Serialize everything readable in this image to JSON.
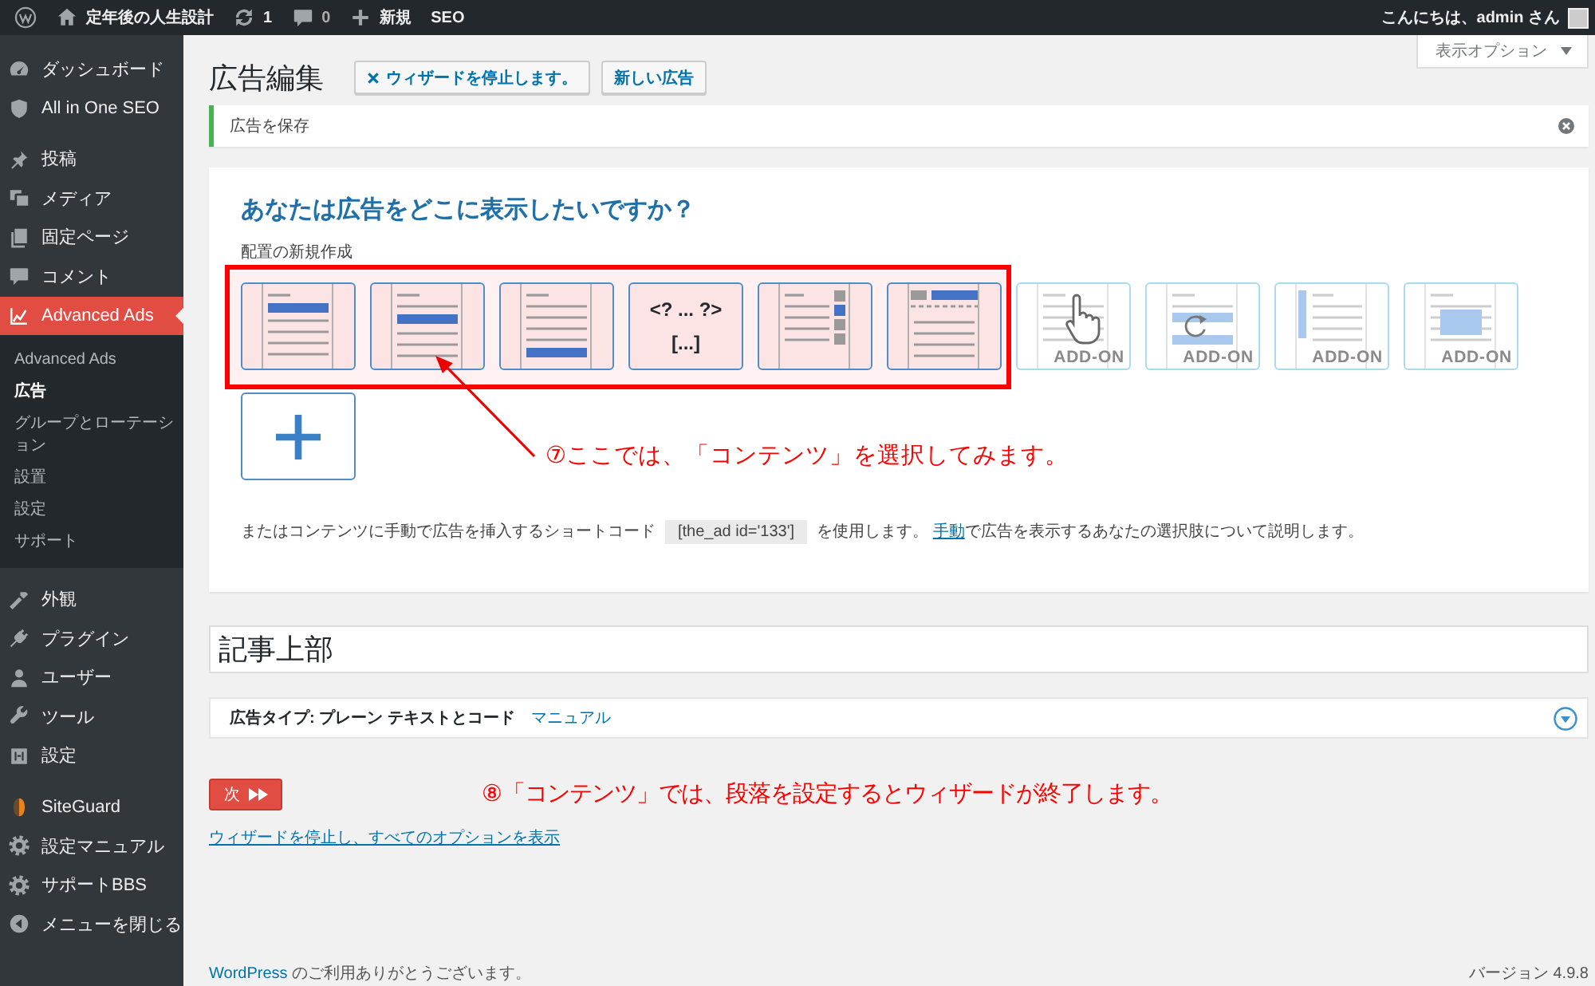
{
  "admin_bar": {
    "site_name": "定年後の人生設計",
    "updates": "1",
    "comments": "0",
    "new_label": "新規",
    "seo": "SEO",
    "greeting": "こんにちは、admin さん"
  },
  "sidebar": {
    "groups": [
      [
        {
          "label": "ダッシュボード",
          "selected": false
        },
        {
          "label": "All in One SEO",
          "selected": false
        }
      ],
      [
        {
          "label": "投稿",
          "selected": false
        },
        {
          "label": "メディア",
          "selected": false
        },
        {
          "label": "固定ページ",
          "selected": false
        },
        {
          "label": "コメント",
          "selected": false
        },
        {
          "label": "Advanced Ads",
          "selected": true,
          "children": [
            {
              "label": "Advanced Ads",
              "selected": false
            },
            {
              "label": "広告",
              "selected": true
            },
            {
              "label": "グループとローテーション",
              "selected": false
            },
            {
              "label": "設置",
              "selected": false
            },
            {
              "label": "設定",
              "selected": false
            },
            {
              "label": "サポート",
              "selected": false
            }
          ]
        }
      ],
      [
        {
          "label": "外観",
          "selected": false
        },
        {
          "label": "プラグイン",
          "selected": false
        },
        {
          "label": "ユーザー",
          "selected": false
        },
        {
          "label": "ツール",
          "selected": false
        },
        {
          "label": "設定",
          "selected": false
        }
      ],
      [
        {
          "label": "SiteGuard",
          "selected": false
        },
        {
          "label": "設定マニュアル",
          "selected": false
        },
        {
          "label": "サポートBBS",
          "selected": false
        },
        {
          "label": "メニューを閉じる",
          "selected": false
        }
      ]
    ]
  },
  "screen_options": {
    "label": "表示オプション",
    "expanded": false
  },
  "header": {
    "title": "広告編集",
    "buttons": [
      {
        "label": "ウィザードを停止します。",
        "kind": "close"
      },
      {
        "label": "新しい広告",
        "kind": "plain"
      }
    ]
  },
  "notice": {
    "text": "広告を保存"
  },
  "wizard": {
    "heading": "あなたは広告をどこに表示したいですか？",
    "label": "配置の新規作成",
    "placements": [
      {
        "kind": "top-bar",
        "highlighted": true,
        "disabled": false
      },
      {
        "kind": "middle-bar",
        "highlighted": true,
        "disabled": false
      },
      {
        "kind": "bottom-bar",
        "highlighted": true,
        "disabled": false
      },
      {
        "kind": "code",
        "lines": [
          "<? ... ?>",
          "[...]"
        ],
        "highlighted": true,
        "disabled": false
      },
      {
        "kind": "side-squares",
        "highlighted": true,
        "disabled": false
      },
      {
        "kind": "header-strip",
        "highlighted": true,
        "disabled": false
      },
      {
        "kind": "hand",
        "badge": "ADD-ON",
        "highlighted": false,
        "disabled": true
      },
      {
        "kind": "rotate",
        "badge": "ADD-ON",
        "highlighted": false,
        "disabled": true
      },
      {
        "kind": "left-bar",
        "badge": "ADD-ON",
        "highlighted": false,
        "disabled": true
      },
      {
        "kind": "center-block",
        "badge": "ADD-ON",
        "highlighted": false,
        "disabled": true
      }
    ],
    "help": {
      "before": "またはコンテンツに手動で広告を挿入するショートコード",
      "code": "[the_ad id='133']",
      "middle": "を使用します。",
      "link": "手動",
      "after": "で広告を表示するあなたの選択肢について説明します。"
    }
  },
  "ad_title": {
    "value": "記事上部"
  },
  "ad_type": {
    "label": "広告タイプ: プレーン テキストとコード",
    "link": "マニュアル",
    "expanded": false
  },
  "next_button": {
    "label": "次"
  },
  "stop_link": "ウィザードを停止し、すべてのオプションを表示",
  "annotations": [
    {
      "text": "⑦ここでは、「コンテンツ」を選択してみます。"
    },
    {
      "text": "⑧「コンテンツ」では、段落を設定するとウィザードが終了します。"
    }
  ],
  "footer": {
    "link": "WordPress",
    "text": "のご利用ありがとうございます。",
    "version": "バージョン 4.9.8"
  }
}
